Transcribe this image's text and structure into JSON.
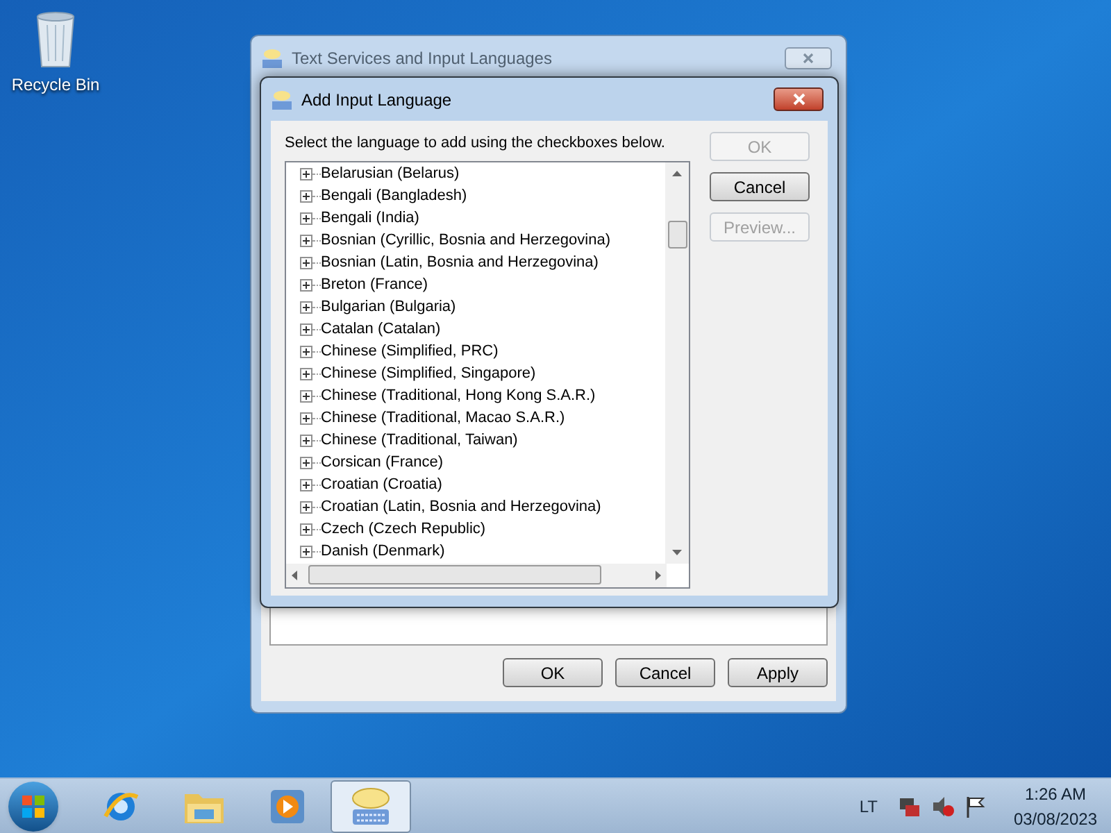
{
  "desktop": {
    "icons": [
      {
        "label": "Recycle Bin"
      }
    ]
  },
  "main_window": {
    "title": "Text Services and Input Languages",
    "buttons": [
      {
        "label": "OK",
        "disabled": false
      },
      {
        "label": "Cancel",
        "disabled": false
      },
      {
        "label": "Apply",
        "disabled": false
      }
    ]
  },
  "dialog": {
    "title": "Add Input Language",
    "instruction": "Select the language to add using the checkboxes below.",
    "languages": [
      {
        "label": "Belarusian (Belarus)",
        "expanded": false
      },
      {
        "label": "Bengali (Bangladesh)",
        "expanded": false
      },
      {
        "label": "Bengali (India)",
        "expanded": false
      },
      {
        "label": "Bosnian (Cyrillic, Bosnia and Herzegovina)",
        "expanded": false
      },
      {
        "label": "Bosnian (Latin, Bosnia and Herzegovina)",
        "expanded": false
      },
      {
        "label": "Breton (France)",
        "expanded": false
      },
      {
        "label": "Bulgarian (Bulgaria)",
        "expanded": false
      },
      {
        "label": "Catalan (Catalan)",
        "expanded": false
      },
      {
        "label": "Chinese (Simplified, PRC)",
        "expanded": false
      },
      {
        "label": "Chinese (Simplified, Singapore)",
        "expanded": false
      },
      {
        "label": "Chinese (Traditional, Hong Kong S.A.R.)",
        "expanded": false
      },
      {
        "label": "Chinese (Traditional, Macao S.A.R.)",
        "expanded": false
      },
      {
        "label": "Chinese (Traditional, Taiwan)",
        "expanded": false
      },
      {
        "label": "Corsican (France)",
        "expanded": false
      },
      {
        "label": "Croatian (Croatia)",
        "expanded": false
      },
      {
        "label": "Croatian (Latin, Bosnia and Herzegovina)",
        "expanded": false
      },
      {
        "label": "Czech (Czech Republic)",
        "expanded": false
      },
      {
        "label": "Danish (Denmark)",
        "expanded": false
      }
    ],
    "buttons": [
      {
        "label": "OK",
        "disabled": true
      },
      {
        "label": "Cancel",
        "disabled": false
      },
      {
        "label": "Preview...",
        "disabled": true
      }
    ]
  },
  "taskbar": {
    "items": [
      {
        "kind": "browser",
        "selected": false
      },
      {
        "kind": "folder",
        "selected": false
      },
      {
        "kind": "media",
        "selected": false
      },
      {
        "kind": "keyboard",
        "selected": true
      }
    ],
    "language": "LT",
    "time": "1:26 AM",
    "date": "03/08/2023"
  }
}
